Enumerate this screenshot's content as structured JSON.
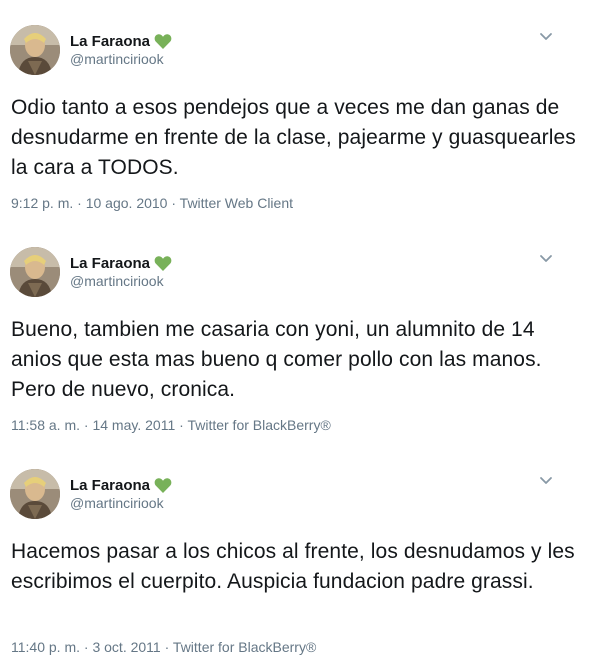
{
  "tweets": [
    {
      "display_name": "La Faraona",
      "emoji_icon": "green-heart-icon",
      "handle": "@martinciriook",
      "text": "Odio tanto a esos pendejos que a veces me dan ganas de desnudarme en frente de la clase, pajearme y guasquearles la cara a TODOS.",
      "time": "9:12 p. m.",
      "date": "10 ago. 2010",
      "source": "Twitter Web Client"
    },
    {
      "display_name": "La Faraona",
      "emoji_icon": "green-heart-icon",
      "handle": "@martinciriook",
      "text": "Bueno, tambien me casaria con yoni, un alumnito de 14 anios que esta mas bueno q comer pollo con las manos. Pero de nuevo, cronica.",
      "time": "11:58 a. m.",
      "date": "14 may. 2011",
      "source": "Twitter for BlackBerry®"
    },
    {
      "display_name": "La Faraona",
      "emoji_icon": "green-heart-icon",
      "handle": "@martinciriook",
      "text": "Hacemos pasar a los chicos al frente, los desnudamos y les escribimos el cuerpito. Auspicia fundacion padre grassi.",
      "time": "11:40 p. m.",
      "date": "3 oct. 2011",
      "source": "Twitter for BlackBerry®"
    }
  ],
  "separator": " · ",
  "colors": {
    "text": "#14171a",
    "secondary": "#657786",
    "heart": "#78b159"
  }
}
